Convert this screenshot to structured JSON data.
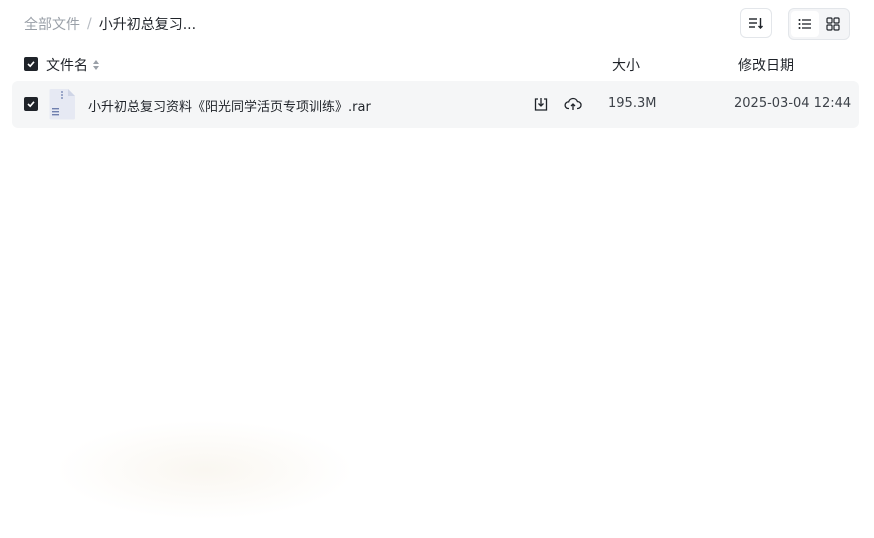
{
  "breadcrumb": {
    "root": "全部文件",
    "separator": "/",
    "current": "小升初总复习..."
  },
  "toolbar": {
    "sort_icon": "sort-lines-icon",
    "view_list_icon": "list-view-icon",
    "view_grid_icon": "grid-view-icon",
    "active_view": "list"
  },
  "table": {
    "headers": {
      "name": "文件名",
      "size": "大小",
      "date": "修改日期"
    },
    "rows": [
      {
        "checked": true,
        "icon": "rar-archive-icon",
        "name": "小升初总复习资料《阳光同学活页专项训练》.rar",
        "size": "195.3M",
        "date": "2025-03-04 12:44"
      }
    ]
  },
  "colors": {
    "text_primary": "#1f2329",
    "text_muted": "#9aa0a8",
    "row_highlight": "#f5f6f7",
    "checkbox_fill": "#1f2329"
  }
}
